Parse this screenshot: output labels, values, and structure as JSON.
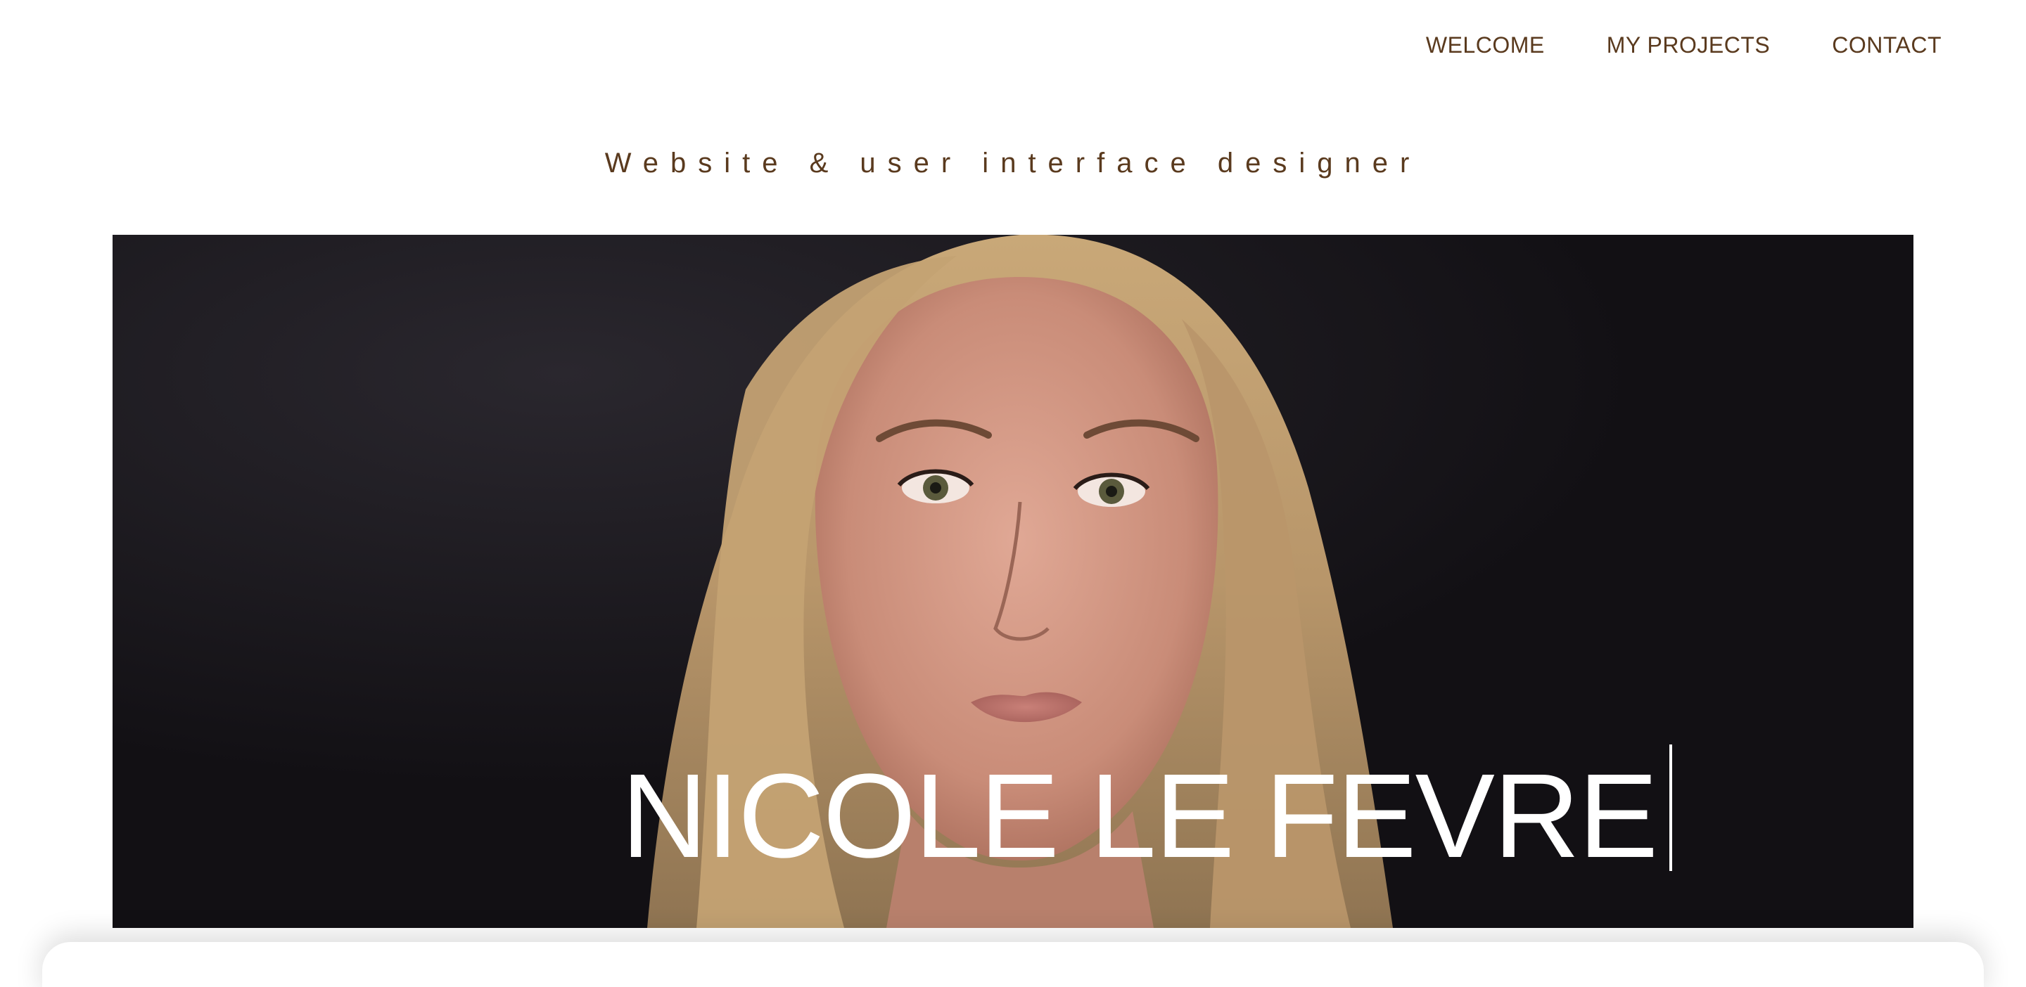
{
  "nav": {
    "items": [
      {
        "label": "WELCOME"
      },
      {
        "label": "MY PROJECTS"
      },
      {
        "label": "CONTACT"
      }
    ]
  },
  "tagline": "Website & user interface designer",
  "hero": {
    "name": "NICOLE LE FEVRE",
    "photo_description_icon": "portrait-photo"
  },
  "colors": {
    "accent_text": "#5a3a1e",
    "hero_background": "#141216",
    "hero_text": "#ffffff"
  }
}
